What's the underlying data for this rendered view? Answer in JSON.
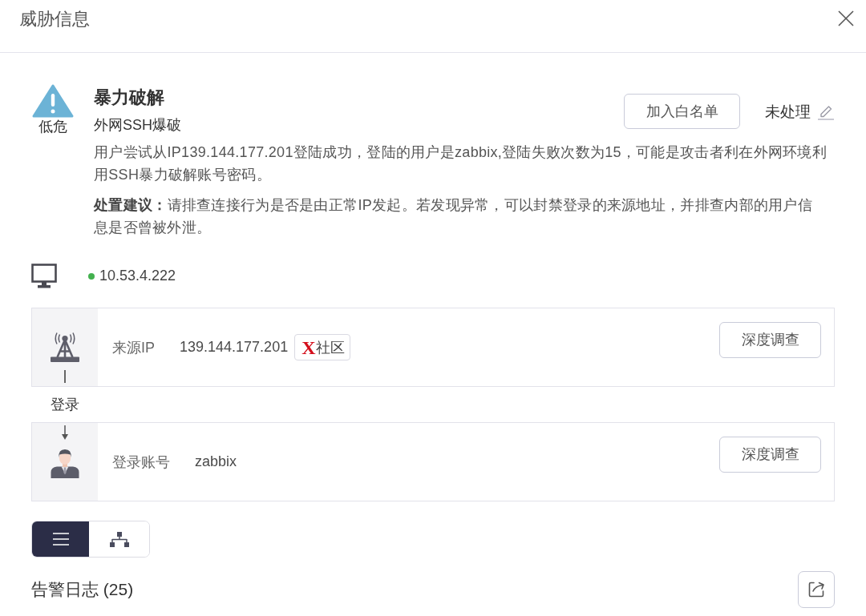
{
  "dialog": {
    "title": "威胁信息"
  },
  "alert": {
    "severity": {
      "kind": "low",
      "label": "低危"
    },
    "title": "暴力破解",
    "subtitle": "外网SSH爆破",
    "description": "用户尝试从IP139.144.177.201登陆成功，登陆的用户是zabbix,登陆失败次数为15，可能是攻击者利在外网环境利用SSH暴力破解账号密码。",
    "advice": "**处置建议：**请排查连接行为是否是由正常IP发起。若发现异常，可以封禁登录的来源地址，并排查内部的用户信息是否曾被外泄。",
    "whitelist_button": "加入白名单",
    "status": "未处理"
  },
  "host": {
    "ip": "10.53.4.222",
    "online": true
  },
  "chain": [
    {
      "kind": "source",
      "label": "来源IP",
      "value": "139.144.177.201",
      "tag": {
        "mark": "X",
        "text": "社区"
      },
      "button": "深度调查"
    },
    {
      "kind": "account",
      "via": "登录",
      "label": "登录账号",
      "value": "zabbix",
      "button": "深度调查"
    }
  ],
  "view_toggle": [
    {
      "kind": "list",
      "selected": true
    },
    {
      "kind": "tree",
      "selected": false
    }
  ],
  "log": {
    "title": "告警日志 (25)"
  }
}
